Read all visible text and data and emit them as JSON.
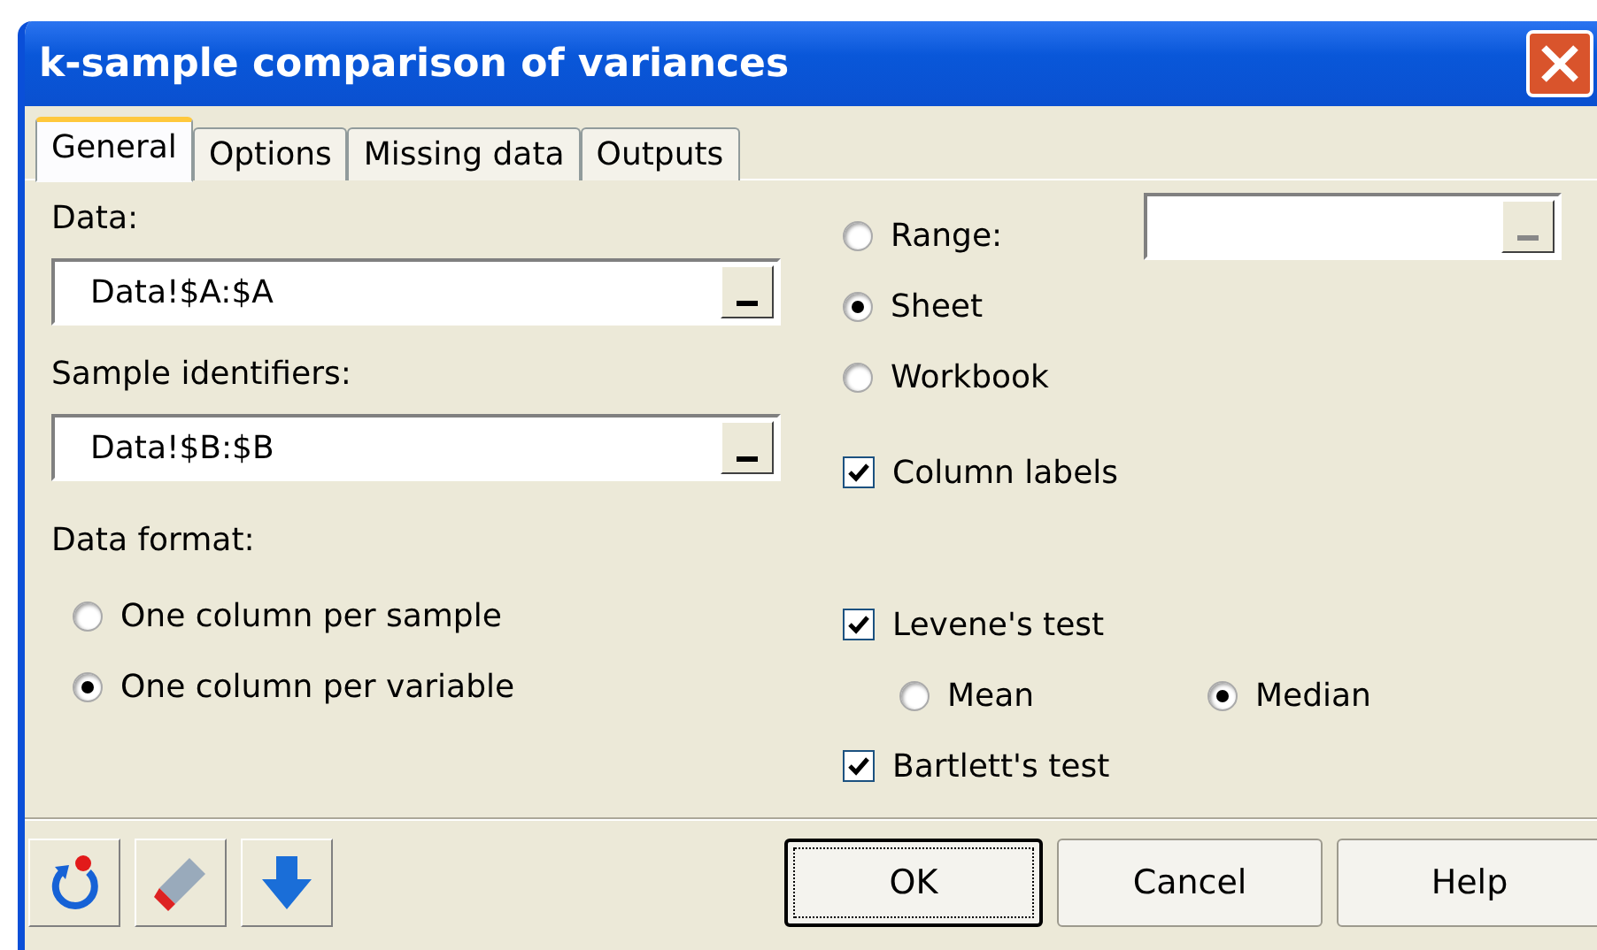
{
  "window": {
    "title": "k-sample comparison of variances"
  },
  "tabs": [
    {
      "label": "General",
      "selected": true
    },
    {
      "label": "Options",
      "selected": false
    },
    {
      "label": "Missing data",
      "selected": false
    },
    {
      "label": "Outputs",
      "selected": false
    }
  ],
  "data": {
    "label": "Data:",
    "value": "Data!$A:$A"
  },
  "sample_identifiers": {
    "label": "Sample identifiers:",
    "value": "Data!$B:$B"
  },
  "data_format": {
    "label": "Data format:",
    "options": [
      {
        "label": "One column per sample",
        "selected": false
      },
      {
        "label": "One column per variable",
        "selected": true
      }
    ]
  },
  "output_location": [
    {
      "label": "Range:",
      "selected": false
    },
    {
      "label": "Sheet",
      "selected": true
    },
    {
      "label": "Workbook",
      "selected": false
    }
  ],
  "column_labels": {
    "label": "Column labels",
    "checked": true
  },
  "levene": {
    "label": "Levene's test",
    "checked": true,
    "options": [
      {
        "label": "Mean",
        "selected": false
      },
      {
        "label": "Median",
        "selected": true
      }
    ]
  },
  "bartlett": {
    "label": "Bartlett's test",
    "checked": true
  },
  "buttons": [
    {
      "label": "OK",
      "focused": true
    },
    {
      "label": "Cancel",
      "focused": false
    },
    {
      "label": "Help",
      "focused": false
    }
  ]
}
